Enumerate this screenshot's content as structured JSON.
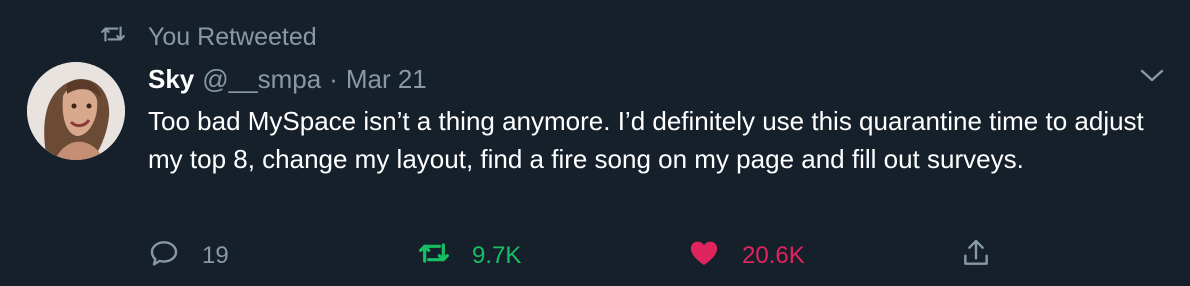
{
  "retweet_context": {
    "text": "You Retweeted"
  },
  "tweet": {
    "author_name": "Sky",
    "handle": "@__smpa",
    "separator": "·",
    "date": "Mar 21",
    "text": "Too bad MySpace isn’t a thing anymore. I’d definitely use this quarantine time to adjust my top 8, change my layout, find a fire song on my page and fill out surveys."
  },
  "actions": {
    "reply_count": "19",
    "retweet_count": "9.7K",
    "like_count": "20.6K"
  },
  "colors": {
    "background": "#15202b",
    "muted": "#8899a6",
    "retweet_active": "#17bf63",
    "like_active": "#e0245e"
  },
  "icons": {
    "retweet_context": "retweet-icon",
    "more": "chevron-down-icon",
    "reply": "reply-icon",
    "retweet": "retweet-icon",
    "like": "heart-icon",
    "share": "share-icon"
  }
}
